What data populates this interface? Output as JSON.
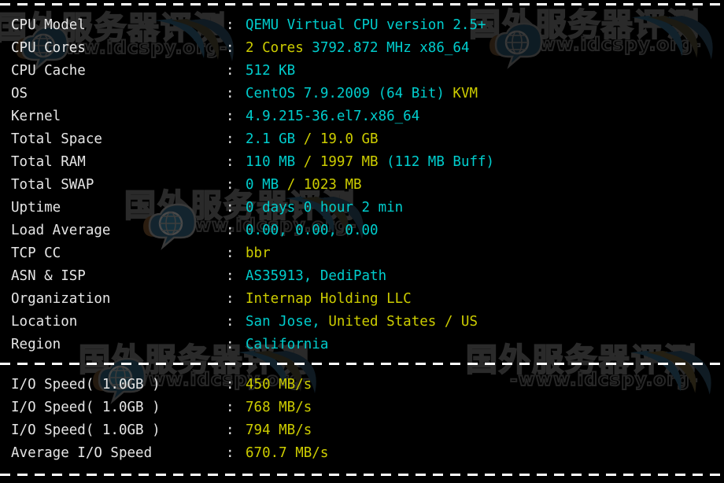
{
  "terminal": {
    "background_color": "#000000",
    "label_color": "#e6e6e6",
    "cyan_color": "#00cdcd",
    "yellow_color": "#cdcd00",
    "separator_char": "-"
  },
  "watermark": {
    "chinese_text": "国外服务器评测",
    "url_text": "-www.idcspy.org-"
  },
  "system_info": [
    {
      "label": "CPU Model",
      "separator": ":",
      "segments": [
        {
          "text": "QEMU Virtual CPU version 2.5+",
          "color": "cyan"
        }
      ]
    },
    {
      "label": "CPU Cores",
      "separator": ":",
      "segments": [
        {
          "text": "2 Cores",
          "color": "yellow"
        },
        {
          "text": " 3792.872 MHz x86_64",
          "color": "cyan"
        }
      ]
    },
    {
      "label": "CPU Cache",
      "separator": ":",
      "segments": [
        {
          "text": "512 KB",
          "color": "cyan"
        }
      ]
    },
    {
      "label": "OS",
      "separator": ":",
      "segments": [
        {
          "text": "CentOS 7.9.2009 (64 Bit) ",
          "color": "cyan"
        },
        {
          "text": "KVM",
          "color": "yellow"
        }
      ]
    },
    {
      "label": "Kernel",
      "separator": ":",
      "segments": [
        {
          "text": "4.9.215-36.el7.x86_64",
          "color": "cyan"
        }
      ]
    },
    {
      "label": "Total Space",
      "separator": ":",
      "segments": [
        {
          "text": "2.1 GB ",
          "color": "cyan"
        },
        {
          "text": "/ 19.0 GB",
          "color": "yellow"
        }
      ]
    },
    {
      "label": "Total RAM",
      "separator": ":",
      "segments": [
        {
          "text": "110 MB ",
          "color": "cyan"
        },
        {
          "text": "/ 1997 MB ",
          "color": "yellow"
        },
        {
          "text": "(112 MB Buff)",
          "color": "cyan"
        }
      ]
    },
    {
      "label": "Total SWAP",
      "separator": ":",
      "segments": [
        {
          "text": "0 MB ",
          "color": "cyan"
        },
        {
          "text": "/ 1023 MB",
          "color": "yellow"
        }
      ]
    },
    {
      "label": "Uptime",
      "separator": ":",
      "segments": [
        {
          "text": "0 days 0 hour 2 min",
          "color": "cyan"
        }
      ]
    },
    {
      "label": "Load Average",
      "separator": ":",
      "segments": [
        {
          "text": "0.00, 0.00, 0.00",
          "color": "cyan"
        }
      ]
    },
    {
      "label": "TCP CC",
      "separator": ":",
      "segments": [
        {
          "text": "bbr",
          "color": "yellow"
        }
      ]
    },
    {
      "label": "ASN & ISP",
      "separator": ":",
      "segments": [
        {
          "text": "AS35913, DediPath",
          "color": "cyan"
        }
      ]
    },
    {
      "label": "Organization",
      "separator": ":",
      "segments": [
        {
          "text": "Internap Holding LLC",
          "color": "yellow"
        }
      ]
    },
    {
      "label": "Location",
      "separator": ":",
      "segments": [
        {
          "text": "San Jose, ",
          "color": "cyan"
        },
        {
          "text": "United States / US",
          "color": "yellow"
        }
      ]
    },
    {
      "label": "Region",
      "separator": ":",
      "segments": [
        {
          "text": "California",
          "color": "cyan"
        }
      ]
    }
  ],
  "io_results": [
    {
      "label": "I/O Speed( 1.0GB )",
      "separator": ":",
      "segments": [
        {
          "text": "450 MB/s",
          "color": "yellow"
        }
      ]
    },
    {
      "label": "I/O Speed( 1.0GB )",
      "separator": ":",
      "segments": [
        {
          "text": "768 MB/s",
          "color": "yellow"
        }
      ]
    },
    {
      "label": "I/O Speed( 1.0GB )",
      "separator": ":",
      "segments": [
        {
          "text": "794 MB/s",
          "color": "yellow"
        }
      ]
    },
    {
      "label": "Average I/O Speed",
      "separator": ":",
      "segments": [
        {
          "text": "670.7 MB/s",
          "color": "yellow"
        }
      ]
    }
  ]
}
